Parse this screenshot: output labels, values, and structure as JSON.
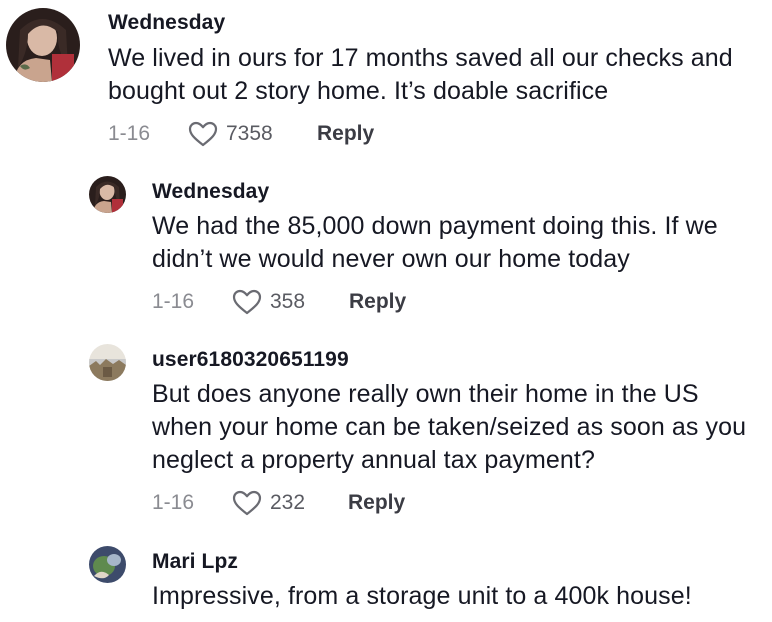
{
  "comments": [
    {
      "username": "Wednesday",
      "text": "We lived in ours for 17 months saved all our checks and bought out 2 story home. It’s doable sacrifice",
      "date": "1-16",
      "likes": "7358",
      "reply_label": "Reply",
      "avatar_colors": [
        "#3a2a26",
        "#d9b9a6",
        "#b0303a"
      ]
    },
    {
      "username": "Wednesday",
      "text": "We had the 85,000 down payment doing this. If we didn’t we would never own our home today",
      "date": "1-16",
      "likes": "358",
      "reply_label": "Reply",
      "avatar_colors": [
        "#3a2a26",
        "#d9b9a6",
        "#b0303a"
      ]
    },
    {
      "username": "user6180320651199",
      "text": "But does anyone really own their home in the US when your home can be taken/seized as soon as you neglect a property annual tax payment?",
      "date": "1-16",
      "likes": "232",
      "reply_label": "Reply",
      "avatar_colors": [
        "#c9c9c9",
        "#8c7a5e",
        "#e8e4dc"
      ]
    },
    {
      "username": "Mari Lpz",
      "text": "Impressive, from a storage unit to a 400k house!",
      "avatar_colors": [
        "#3d4b6b",
        "#5f8a4e",
        "#a6b6c9"
      ]
    }
  ],
  "like_icon": "heart-outline-icon"
}
